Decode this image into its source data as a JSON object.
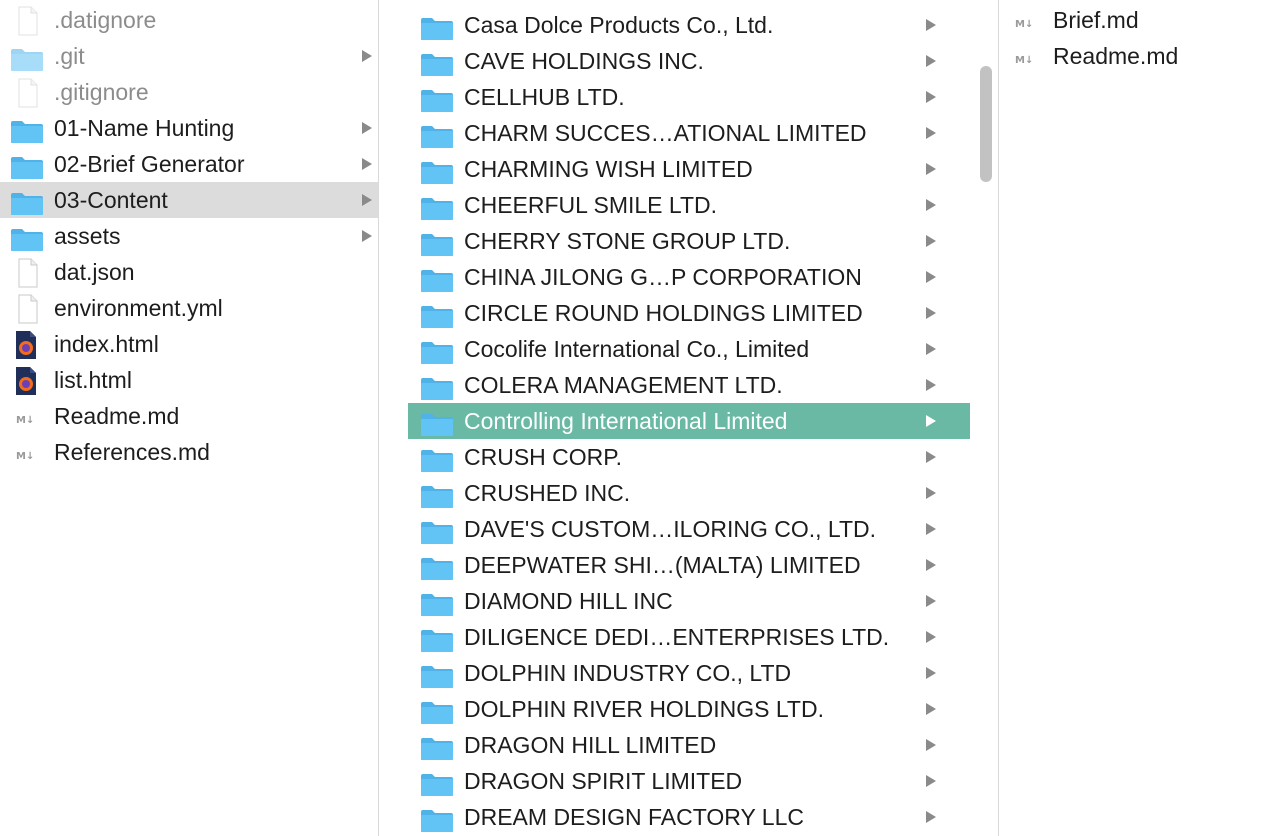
{
  "columns": [
    {
      "items": [
        {
          "name": ".datignore",
          "kind": "doc",
          "dim": true
        },
        {
          "name": ".git",
          "kind": "folder",
          "dim": true,
          "arrow": true
        },
        {
          "name": ".gitignore",
          "kind": "doc",
          "dim": true
        },
        {
          "name": "01-Name Hunting",
          "kind": "folder",
          "arrow": true
        },
        {
          "name": "02-Brief Generator",
          "kind": "folder",
          "arrow": true
        },
        {
          "name": "03-Content",
          "kind": "folder",
          "arrow": true,
          "selected": "gray"
        },
        {
          "name": "assets",
          "kind": "folder",
          "arrow": true
        },
        {
          "name": "dat.json",
          "kind": "doc"
        },
        {
          "name": "environment.yml",
          "kind": "doc"
        },
        {
          "name": "index.html",
          "kind": "html"
        },
        {
          "name": "list.html",
          "kind": "html"
        },
        {
          "name": "Readme.md",
          "kind": "md"
        },
        {
          "name": "References.md",
          "kind": "md"
        }
      ]
    },
    {
      "items": [
        {
          "name": "Casa Dolce Products Co., Ltd.",
          "kind": "folder",
          "arrow": true
        },
        {
          "name": "CAVE HOLDINGS INC.",
          "kind": "folder",
          "arrow": true
        },
        {
          "name": "CELLHUB LTD.",
          "kind": "folder",
          "arrow": true
        },
        {
          "name": "CHARM SUCCES…ATIONAL LIMITED",
          "kind": "folder",
          "arrow": true
        },
        {
          "name": "CHARMING WISH LIMITED",
          "kind": "folder",
          "arrow": true
        },
        {
          "name": "CHEERFUL SMILE LTD.",
          "kind": "folder",
          "arrow": true
        },
        {
          "name": "CHERRY STONE GROUP LTD.",
          "kind": "folder",
          "arrow": true
        },
        {
          "name": "CHINA JILONG G…P CORPORATION",
          "kind": "folder",
          "arrow": true
        },
        {
          "name": "CIRCLE ROUND HOLDINGS LIMITED",
          "kind": "folder",
          "arrow": true
        },
        {
          "name": "Cocolife International Co., Limited",
          "kind": "folder",
          "arrow": true
        },
        {
          "name": "COLERA MANAGEMENT LTD.",
          "kind": "folder",
          "arrow": true
        },
        {
          "name": "Controlling International Limited",
          "kind": "folder",
          "arrow": true,
          "selected": "green"
        },
        {
          "name": "CRUSH CORP.",
          "kind": "folder",
          "arrow": true
        },
        {
          "name": "CRUSHED INC.",
          "kind": "folder",
          "arrow": true
        },
        {
          "name": "DAVE'S CUSTOM…ILORING CO., LTD.",
          "kind": "folder",
          "arrow": true
        },
        {
          "name": "DEEPWATER SHI…(MALTA) LIMITED",
          "kind": "folder",
          "arrow": true
        },
        {
          "name": "DIAMOND HILL INC",
          "kind": "folder",
          "arrow": true
        },
        {
          "name": "DILIGENCE DEDI…ENTERPRISES LTD.",
          "kind": "folder",
          "arrow": true
        },
        {
          "name": "DOLPHIN INDUSTRY CO., LTD",
          "kind": "folder",
          "arrow": true
        },
        {
          "name": "DOLPHIN RIVER HOLDINGS LTD.",
          "kind": "folder",
          "arrow": true
        },
        {
          "name": "DRAGON HILL LIMITED",
          "kind": "folder",
          "arrow": true
        },
        {
          "name": "DRAGON SPIRIT LIMITED",
          "kind": "folder",
          "arrow": true
        },
        {
          "name": "DREAM DESIGN FACTORY LLC",
          "kind": "folder",
          "arrow": true
        }
      ]
    },
    {
      "items": [
        {
          "name": "Brief.md",
          "kind": "md"
        },
        {
          "name": "Readme.md",
          "kind": "md"
        }
      ]
    }
  ],
  "colors": {
    "folder": "#62c3f5",
    "folder_tab": "#4fb3ea",
    "selected_active": "#69b9a4",
    "selected_inactive": "#dcdcdc",
    "firefox_orange": "#f36b1c"
  }
}
